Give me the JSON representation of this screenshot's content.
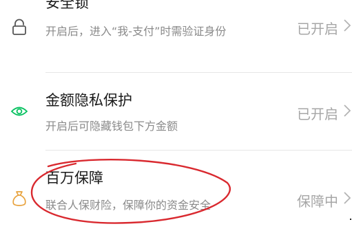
{
  "rows": [
    {
      "title": "安全锁",
      "description": "开启后，进入“我-支付”时需验证身份",
      "status": "已开启",
      "icon": "lock-icon"
    },
    {
      "title": "金额隐私保护",
      "description": "开启后可隐藏钱包下方金额",
      "status": "已开启",
      "icon": "eye-icon"
    },
    {
      "title": "百万保障",
      "description": "联合人保财险，保障你的资金安全",
      "status": "保障中",
      "icon": "money-bag-icon"
    }
  ],
  "colors": {
    "title": "#1a1a1a",
    "description": "#8a8a8a",
    "status": "#a6a6a6",
    "lock_icon": "#555555",
    "eye_icon": "#07c160",
    "bag_icon": "#e8a23c",
    "annotation": "#d9292f"
  }
}
